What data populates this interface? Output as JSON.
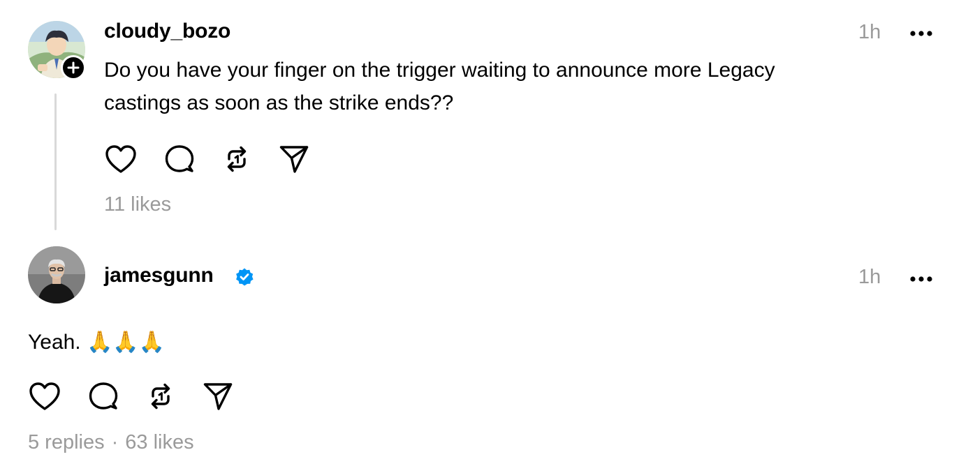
{
  "posts": [
    {
      "username": "cloudy_bozo",
      "time": "1h",
      "text_line1": "Do you have your finger on the trigger waiting to announce more Legacy",
      "text_line2": "castings as soon as the strike ends??",
      "likes": "11 likes"
    },
    {
      "username": "jamesgunn",
      "verified": true,
      "time": "1h",
      "text": "Yeah.",
      "emoji": "🙏🙏🙏",
      "replies": "5 replies",
      "separator": "·",
      "likes": "63 likes"
    }
  ],
  "icons": {
    "like": "heart-icon",
    "reply": "comment-icon",
    "repost": "repost-icon",
    "share": "send-icon",
    "more": "more-options-icon",
    "follow": "plus-icon",
    "verified": "verified-badge-icon"
  },
  "colors": {
    "text": "#000000",
    "muted": "#9a9a9a",
    "thread_line": "#d9d9d9",
    "verified": "#0095f6"
  }
}
